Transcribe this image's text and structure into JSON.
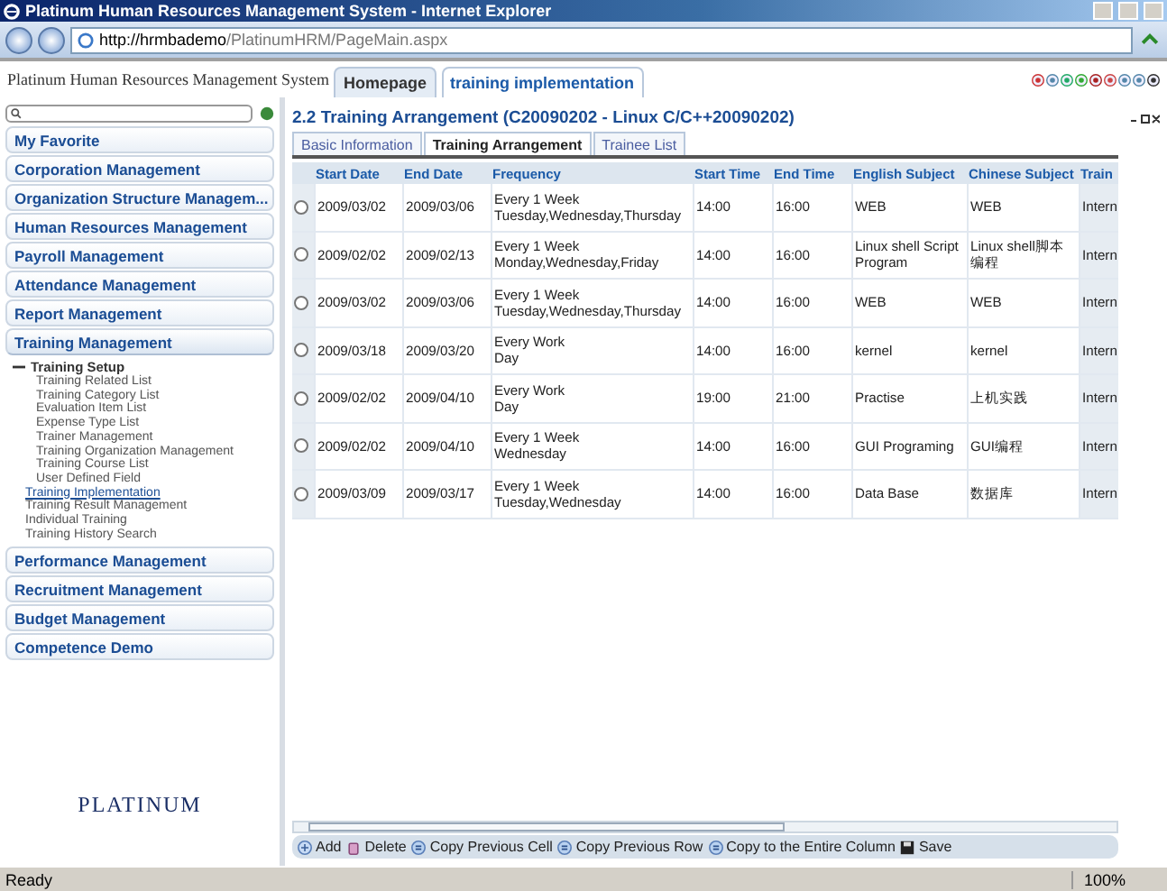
{
  "window": {
    "title": "Platinum Human Resources Management System - Internet Explorer"
  },
  "address_bar": {
    "url_host": "http://hrmbademo",
    "url_path": "/PlatinumHRM/PageMain.aspx"
  },
  "app": {
    "title": "Platinum Human Resources Management System"
  },
  "app_tabs": [
    {
      "label": "Homepage",
      "selected": false
    },
    {
      "label": "training implementation",
      "selected": true
    }
  ],
  "sidebar": {
    "menu": [
      {
        "label": "My Favorite"
      },
      {
        "label": "Corporation Management"
      },
      {
        "label": "Organization Structure Managem..."
      },
      {
        "label": "Human Resources Management"
      },
      {
        "label": "Payroll Management"
      },
      {
        "label": "Attendance Management"
      },
      {
        "label": "Report Management"
      },
      {
        "label": "Training Management",
        "expanded": true,
        "children": [
          {
            "label": "Training Setup",
            "expanded": true,
            "children": [
              {
                "label": "Training Related List",
                "selected": false
              },
              {
                "label": "Training Category List",
                "selected": false
              },
              {
                "label": "Evaluation Item List",
                "selected": false
              },
              {
                "label": "Expense Type List",
                "selected": false
              },
              {
                "label": "Trainer Management",
                "selected": false
              },
              {
                "label": "Training Organization Management",
                "selected": false
              },
              {
                "label": "Training Course List",
                "selected": false
              },
              {
                "label": "User Defined Field",
                "selected": false
              }
            ]
          },
          {
            "label": "Training Implementation",
            "selected": true
          },
          {
            "label": "Training Result Management",
            "selected": false
          },
          {
            "label": "Individual Training",
            "selected": false
          },
          {
            "label": "Training History Search",
            "selected": false
          }
        ]
      },
      {
        "label": "Performance Management"
      },
      {
        "label": "Recruitment Management"
      },
      {
        "label": "Budget Management"
      },
      {
        "label": "Competence Demo"
      }
    ],
    "logo": "PLATINUM"
  },
  "panel": {
    "title": "2.2 Training Arrangement (C20090202 - Linux C/C++20090202)",
    "tabs": [
      {
        "label": "Basic Information",
        "selected": false
      },
      {
        "label": "Training Arrangement",
        "selected": true
      },
      {
        "label": "Trainee List",
        "selected": false
      }
    ],
    "table": {
      "columns": [
        "Start Date",
        "End Date",
        "Frequency",
        "Start Time",
        "End Time",
        "English Subject",
        "Chinese Subject",
        "Train"
      ],
      "rows": [
        {
          "selected": false,
          "start_date": "2009/03/02",
          "end_date": "2009/03/06",
          "frequency": [
            "Every 1 Week",
            "Tuesday,Wednesday,Thursday"
          ],
          "start_time": "14:00",
          "end_time": "16:00",
          "english_subject": "WEB",
          "chinese_subject": "WEB",
          "column_8": "Intern"
        },
        {
          "selected": false,
          "start_date": "2009/02/02",
          "end_date": "2009/02/13",
          "frequency": [
            "Every 1 Week",
            "Monday,Wednesday,Friday"
          ],
          "start_time": "14:00",
          "end_time": "16:00",
          "english_subject": "Linux shell Script Program",
          "chinese_subject": "Linux shell脚本编程",
          "column_8": "Intern"
        },
        {
          "selected": false,
          "start_date": "2009/03/02",
          "end_date": "2009/03/06",
          "frequency": [
            "Every 1 Week",
            "Tuesday,Wednesday,Thursday"
          ],
          "start_time": "14:00",
          "end_time": "16:00",
          "english_subject": "WEB",
          "chinese_subject": "WEB",
          "column_8": "Intern"
        },
        {
          "selected": false,
          "start_date": "2009/03/18",
          "end_date": "2009/03/20",
          "frequency": [
            "Every Work",
            "Day"
          ],
          "start_time": "14:00",
          "end_time": "16:00",
          "english_subject": "kernel",
          "chinese_subject": "kernel",
          "column_8": "Intern"
        },
        {
          "selected": false,
          "start_date": "2009/02/02",
          "end_date": "2009/04/10",
          "frequency": [
            "Every Work",
            "Day"
          ],
          "start_time": "19:00",
          "end_time": "21:00",
          "english_subject": "Practise",
          "chinese_subject": "上机实践",
          "column_8": "Intern"
        },
        {
          "selected": false,
          "start_date": "2009/02/02",
          "end_date": "2009/04/10",
          "frequency": [
            "Every 1 Week",
            "Wednesday"
          ],
          "start_time": "14:00",
          "end_time": "16:00",
          "english_subject": "GUI Programing",
          "chinese_subject": "GUI编程",
          "column_8": "Intern"
        },
        {
          "selected": false,
          "start_date": "2009/03/09",
          "end_date": "2009/03/17",
          "frequency": [
            "Every 1 Week",
            "Tuesday,Wednesday"
          ],
          "start_time": "14:00",
          "end_time": "16:00",
          "english_subject": "Data Base",
          "chinese_subject": "数据库",
          "column_8": "Intern"
        }
      ]
    },
    "toolbar": [
      {
        "kind": "add",
        "label": "Add"
      },
      {
        "kind": "delete",
        "label": "Delete"
      },
      {
        "kind": "copy_cell",
        "label": "Copy Previous Cell"
      },
      {
        "kind": "copy_row",
        "label": "Copy Previous Row"
      },
      {
        "kind": "copy_column",
        "label": "Copy to the Entire Column"
      },
      {
        "kind": "save",
        "label": "Save"
      }
    ]
  },
  "status_bar": {
    "text": "Ready",
    "zoom": "100%"
  }
}
